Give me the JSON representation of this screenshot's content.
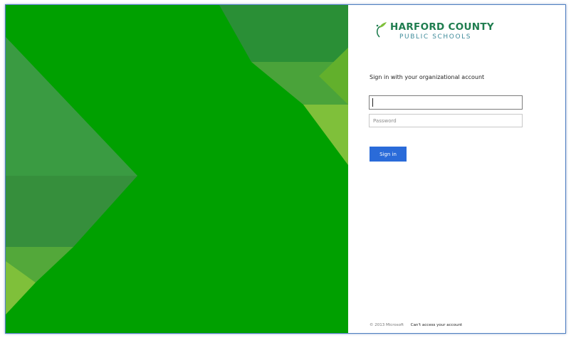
{
  "branding": {
    "logo_icon": "hcps-flame-logo-icon",
    "name_line1": "HARFORD COUNTY",
    "name_line2": "PUBLIC SCHOOLS",
    "primary_color": "#1f7d4f",
    "secondary_color": "#3f8b9a"
  },
  "illustration": {
    "base_color": "#00a000",
    "accent_colors": [
      "#3d9b46",
      "#4aa33a",
      "#62b02c",
      "#7fc03a",
      "#2a8f36"
    ]
  },
  "signin": {
    "heading": "Sign in with your organizational account",
    "username": {
      "value": "",
      "placeholder": ""
    },
    "password": {
      "value": "",
      "placeholder": "Password"
    },
    "button_label": "Sign in",
    "button_color": "#2a6bd9"
  },
  "footer": {
    "copyright": "© 2013 Microsoft",
    "help_link": "Can't access your account"
  }
}
